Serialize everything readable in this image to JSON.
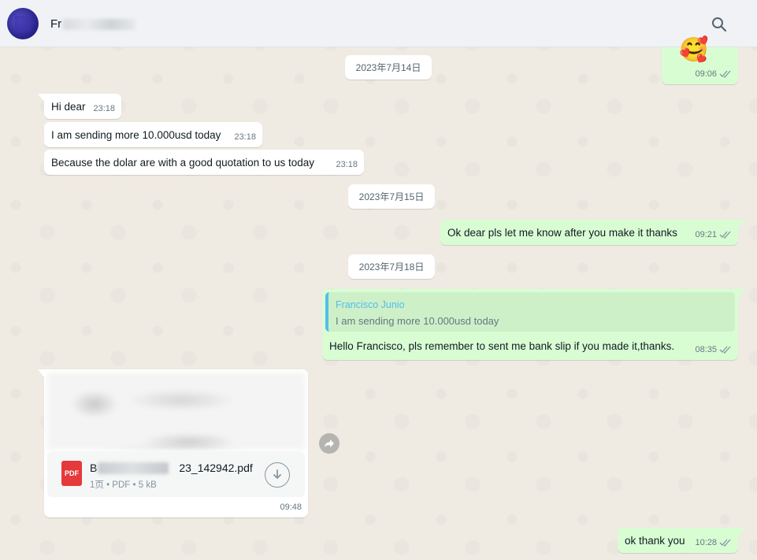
{
  "header": {
    "contact_name": "Fr",
    "search_icon": "search-icon"
  },
  "dates": [
    "2023年7月14日",
    "2023年7月15日",
    "2023年7月18日"
  ],
  "messages": [
    {
      "dir": "out",
      "kind": "sticker",
      "emoji": "🥰",
      "time": "09:06",
      "status": "read"
    },
    {
      "dir": "in",
      "text": "Hi dear",
      "time": "23:18"
    },
    {
      "dir": "in",
      "text": "I am sending more 10.000usd today",
      "time": "23:18"
    },
    {
      "dir": "in",
      "text": "Because the dolar are with a good quotation to us today",
      "time": "23:18"
    },
    {
      "dir": "out",
      "text": "Ok dear pls let me know after you make it thanks",
      "time": "09:21",
      "status": "read"
    },
    {
      "dir": "out",
      "quote": {
        "author": "Francisco Junio",
        "text": "I am sending more 10.000usd today"
      },
      "text": "Hello Francisco, pls remember to sent me bank slip if you made it,thanks.",
      "time": "08:35",
      "status": "read"
    },
    {
      "dir": "in",
      "kind": "document",
      "file": {
        "name": "B",
        "name_suffix": "23_142942.pdf",
        "meta": "1页 • PDF • 5 kB",
        "badge": "PDF"
      },
      "time": "09:48"
    },
    {
      "dir": "out",
      "text": "ok thank you",
      "time": "10:28",
      "status": "read"
    }
  ],
  "colors": {
    "incoming": "#ffffff",
    "outgoing": "#d9fdd3",
    "quote_accent": "#53bdeb",
    "read_ticks": "#667781",
    "pdf_badge": "#e5393b"
  }
}
